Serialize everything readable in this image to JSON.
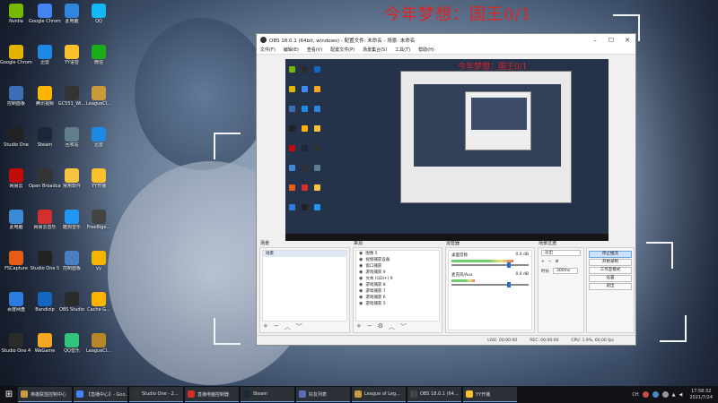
{
  "wallpaper": {
    "headline": "今年梦想：国王0/1",
    "nested_headline": "今年梦想：国王0/1"
  },
  "desktop_icons": [
    {
      "label": "Nvidia",
      "color": "#76b900"
    },
    {
      "label": "Google Chrome",
      "color": "#e0b400"
    },
    {
      "label": "控制面板",
      "color": "#3a6fb4"
    },
    {
      "label": "Studio One",
      "color": "#222"
    },
    {
      "label": "网易云",
      "color": "#c20c0c"
    },
    {
      "label": "此电脑",
      "color": "#3c8ad6"
    },
    {
      "label": "FSCapture",
      "color": "#e55d14"
    },
    {
      "label": "百度网盘",
      "color": "#2d7ddf"
    },
    {
      "label": "Studio One 4",
      "color": "#2b2b2b"
    },
    {
      "label": "Google Chrome",
      "color": "#4285f4"
    },
    {
      "label": "迅雷",
      "color": "#1e88e5"
    },
    {
      "label": "腾讯视频",
      "color": "#ffb400"
    },
    {
      "label": "Steam",
      "color": "#1b2838"
    },
    {
      "label": "Open Broadcaster",
      "color": "#333"
    },
    {
      "label": "网易云音乐",
      "color": "#d32f2f"
    },
    {
      "label": "Studio One 5",
      "color": "#222"
    },
    {
      "label": "Bandizip",
      "color": "#1565c0"
    },
    {
      "label": "WeGame",
      "color": "#f5a623"
    },
    {
      "label": "此电脑",
      "color": "#2e86de"
    },
    {
      "label": "YY语音",
      "color": "#fbc02d"
    },
    {
      "label": "GC551_Wi...",
      "color": "#333"
    },
    {
      "label": "回收站",
      "color": "#607d8b"
    },
    {
      "label": "常用软件",
      "color": "#f6c343"
    },
    {
      "label": "酷狗音乐",
      "color": "#2196f3"
    },
    {
      "label": "控制面板",
      "color": "#4a7fc1"
    },
    {
      "label": "OBS Studio",
      "color": "#2b2b2b"
    },
    {
      "label": "QQ音乐",
      "color": "#31c27c"
    },
    {
      "label": "QQ",
      "color": "#12b7f5"
    },
    {
      "label": "微信",
      "color": "#1aad19"
    },
    {
      "label": "LeagueCl...",
      "color": "#c89b3c"
    },
    {
      "label": "迅雷",
      "color": "#1e88e5"
    },
    {
      "label": "YY开播",
      "color": "#fbc02d"
    },
    {
      "label": "FreeBige...",
      "color": "#444"
    },
    {
      "label": "yy",
      "color": "#f4b400"
    },
    {
      "label": "Cache G...",
      "color": "#ffb300"
    },
    {
      "label": "LeagueCl...",
      "color": "#b8862b"
    }
  ],
  "obs": {
    "title": "OBS 18.0.1 (64bit, windows) - 配置文件: 未命名 - 场景: 未命名",
    "menu": [
      "文件(F)",
      "编辑(E)",
      "查看(V)",
      "配置文件(P)",
      "场景集合(S)",
      "工具(T)",
      "帮助(H)"
    ],
    "docks": {
      "scenes": {
        "title": "场景",
        "items": [
          "场景"
        ]
      },
      "sources": {
        "title": "来源",
        "items": [
          "图像 5",
          "视频捕获设备",
          "窗口捕获",
          "游戏捕获 9",
          "文本 (GDI+) 9",
          "游戏捕获 8",
          "游戏捕获 7",
          "游戏捕获 6",
          "游戏捕获 5"
        ]
      },
      "mixer": {
        "title": "混音器",
        "rows": [
          {
            "name": "桌面音频",
            "db": "0.0 dB",
            "level": 0.8,
            "slider": 0.9
          },
          {
            "name": "麦克风/Aux",
            "db": "0.0 dB",
            "level": 0.3,
            "slider": 0.9
          }
        ]
      },
      "transitions": {
        "title": "场景过渡",
        "selected": "淡出",
        "duration_label": "时长",
        "duration": "300ms"
      },
      "controls": {
        "buttons": [
          "停止推流",
          "开始录制",
          "工作室模式",
          "设置",
          "退出"
        ]
      }
    },
    "status": {
      "live": "LIVE: 00:00:00",
      "rec": "REC: 00:00:00",
      "cpu": "CPU: 1.9%, 60.00 fps"
    }
  },
  "taskbar": {
    "items": [
      {
        "label": "英雄联盟控制中心",
        "color": "#c89b3c"
      },
      {
        "label": "【直播中心】- Goo...",
        "color": "#4285f4"
      },
      {
        "label": "Studio One - 2...",
        "color": "#333"
      },
      {
        "label": "直播电脑控制器",
        "color": "#d32f2f"
      },
      {
        "label": "Steam",
        "color": "#1b2838"
      },
      {
        "label": "好友列表",
        "color": "#5c6bc0"
      },
      {
        "label": "League of Leg...",
        "color": "#c89b3c"
      },
      {
        "label": "OBS 18.0.1 (64...",
        "color": "#444"
      },
      {
        "label": "YY开播",
        "color": "#fbc02d"
      }
    ],
    "tray_lang": "CH",
    "time": "17:58:32",
    "date": "2021/7/24"
  }
}
